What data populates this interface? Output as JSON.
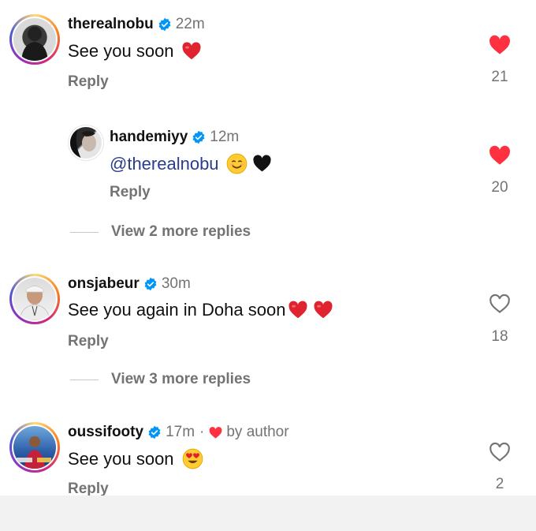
{
  "comments": [
    {
      "username": "therealnobu",
      "time": "22m",
      "text": "See you soon",
      "reply_label": "Reply",
      "likes": "21",
      "liked": true,
      "verified": true
    },
    {
      "username": "handemiyy",
      "time": "12m",
      "mention": "@therealnobu",
      "reply_label": "Reply",
      "likes": "20",
      "liked": true,
      "verified": true
    },
    {
      "username": "onsjabeur",
      "time": "30m",
      "text": "See you again in Doha soon",
      "reply_label": "Reply",
      "likes": "18",
      "liked": false,
      "verified": true
    },
    {
      "username": "oussifooty",
      "time": "17m",
      "separator": "·",
      "by_author": "by author",
      "text": "See you soon",
      "reply_label": "Reply",
      "likes": "2",
      "liked": false,
      "verified": true
    }
  ],
  "view_more": [
    "View 2 more replies",
    "View 3 more replies"
  ],
  "colors": {
    "like_red": "#ff3040",
    "verified_blue": "#0095f6",
    "mention_blue": "#2b3c8f",
    "muted_gray": "#737373"
  }
}
